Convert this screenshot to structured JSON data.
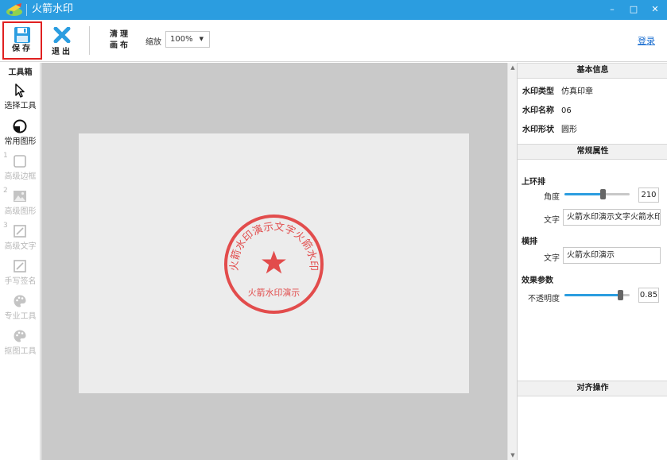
{
  "window": {
    "title": "火箭水印",
    "minimize": "–",
    "maximize": "□",
    "close": "✕"
  },
  "toolbar": {
    "save_label": "保存",
    "exit_label": "退出",
    "clear_line1": "清理",
    "clear_line2": "画布",
    "zoom_label": "缩放",
    "zoom_value": "100%",
    "login_label": "登录"
  },
  "sidebar": {
    "title": "工具箱",
    "tools": [
      {
        "name": "选择工具",
        "num": "",
        "enabled": true,
        "icon": "cursor-icon"
      },
      {
        "name": "常用图形",
        "num": "",
        "enabled": true,
        "icon": "shape-icon"
      },
      {
        "name": "高级边框",
        "num": "1",
        "enabled": false,
        "icon": "border-icon"
      },
      {
        "name": "高级图形",
        "num": "2",
        "enabled": false,
        "icon": "image-icon"
      },
      {
        "name": "高级文字",
        "num": "3",
        "enabled": false,
        "icon": "text-edit-icon"
      },
      {
        "name": "手写签名",
        "num": "",
        "enabled": false,
        "icon": "signature-icon"
      },
      {
        "name": "专业工具",
        "num": "",
        "enabled": false,
        "icon": "palette-icon"
      },
      {
        "name": "抠图工具",
        "num": "",
        "enabled": false,
        "icon": "palette-icon"
      }
    ]
  },
  "stamp": {
    "arc_text": "火箭水印演示文字火箭水印",
    "horizontal_text": "火箭水印演示",
    "color": "#e03030"
  },
  "panel": {
    "basic_info_title": "基本信息",
    "info": [
      {
        "key": "水印类型",
        "value": "仿真印章"
      },
      {
        "key": "水印名称",
        "value": "06"
      },
      {
        "key": "水印形状",
        "value": "圆形"
      }
    ],
    "general_props_title": "常规属性",
    "upper_ring_title": "上环排",
    "angle_label": "角度",
    "angle_value": "210",
    "angle_fraction": 0.58,
    "arc_text_label": "文字",
    "arc_text_value": "火箭水印演示文字火箭水印",
    "horizontal_title": "横排",
    "horizontal_text_label": "文字",
    "horizontal_text_value": "火箭水印演示",
    "effect_title": "效果参数",
    "opacity_label": "不透明度",
    "opacity_value": "0.85",
    "opacity_fraction": 0.85,
    "align_title": "对齐操作"
  },
  "colors": {
    "titlebar": "#2b9de0",
    "accent": "#2b9de0",
    "canvas_bg": "#c9c9c9",
    "page_bg": "#ececec",
    "stamp_red": "#e03030",
    "highlight_border": "#e02020"
  }
}
